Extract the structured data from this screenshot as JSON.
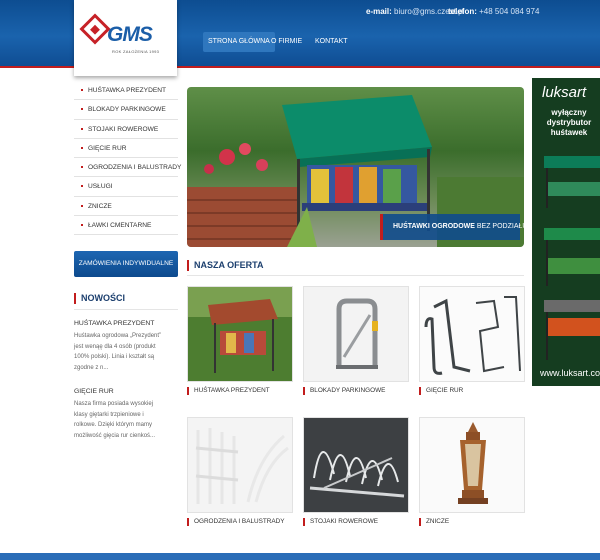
{
  "header": {
    "brand": "GMS",
    "brand_sub": "ROK ZAŁOŻENIA 1993",
    "email_label": "e-mail:",
    "email": "biuro@gms.czest.pl",
    "phone_label": "telefon:",
    "phone": "+48 504 084 974",
    "nav": [
      "STRONA GŁÓWNA",
      "O FIRMIE",
      "KONTAKT"
    ]
  },
  "sidebar": {
    "menu": [
      "HUŚTAWKA PREZYDENT",
      "BLOKADY PARKINGOWE",
      "STOJAKI ROWEROWE",
      "GIĘCIE RUR",
      "OGRODZENIA I BALUSTRADY",
      "USŁUGI",
      "ZNICZE",
      "ŁAWKI CMENTARNE"
    ],
    "custom_button": "ZAMÓWIENIA INDYWIDUALNE",
    "news_title": "NOWOŚCI",
    "news": [
      {
        "title": "HUŚTAWKA PREZYDENT",
        "text": "Huśtawka ogrodowa „Prezydent” jest wenąę dla 4 osób (produkt 100% polski). Linia i kształt są zgodne z n..."
      },
      {
        "title": "GIĘCIE RUR",
        "text": "Nasza firma posiada wysokiej klasy giętarki trzpieniowe i rolkowe. Dzięki którym mamy możliwość gięcia rur cienkoś..."
      }
    ]
  },
  "hero": {
    "caption_bold": "HUŚTAWKI OGRODOWE",
    "caption_rest": " BEZ PODZIAŁU"
  },
  "offer": {
    "title": "NASZA OFERTA",
    "products": [
      "HUŚTAWKA PREZYDENT",
      "BLOKADY PARKINGOWE",
      "GIĘCIE RUR",
      "OGRODZENIA I BALUSTRADY",
      "STOJAKI ROWEROWE",
      "ZNICZE"
    ]
  },
  "banner": {
    "logo": "luksart",
    "text": "wyłączny dystrybutor huśtawek",
    "url": "www.luksart.com"
  }
}
